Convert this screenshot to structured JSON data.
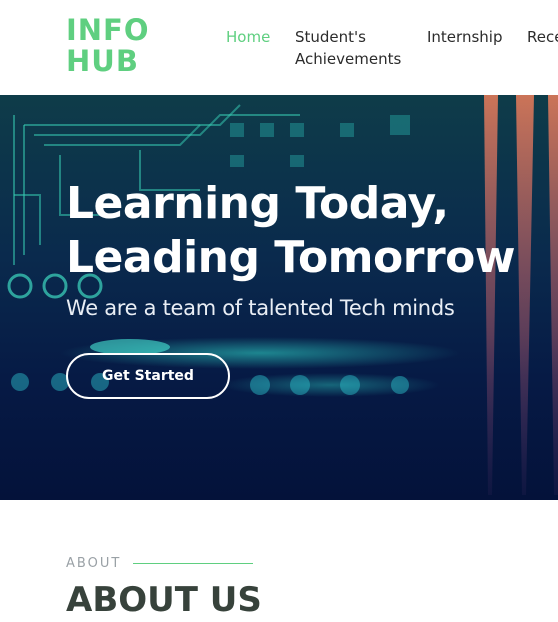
{
  "header": {
    "logo_line1": "INFO",
    "logo_line2": "HUB",
    "nav": [
      {
        "label": "Home"
      },
      {
        "label_line1": "Student's",
        "label_line2": "Achievements"
      },
      {
        "label": "Internship"
      },
      {
        "label": "Rece"
      }
    ]
  },
  "hero": {
    "title_line1": "Learning Today,",
    "title_line2": "Leading Tomorrow",
    "subtitle": "We are a team of talented Tech minds",
    "cta_label": "Get Started"
  },
  "about": {
    "label": "ABOUT",
    "title": "ABOUT US"
  },
  "colors": {
    "accent": "#5fcf80",
    "heading_dark": "#37423b",
    "hero_bg": "#0a2a4d"
  }
}
